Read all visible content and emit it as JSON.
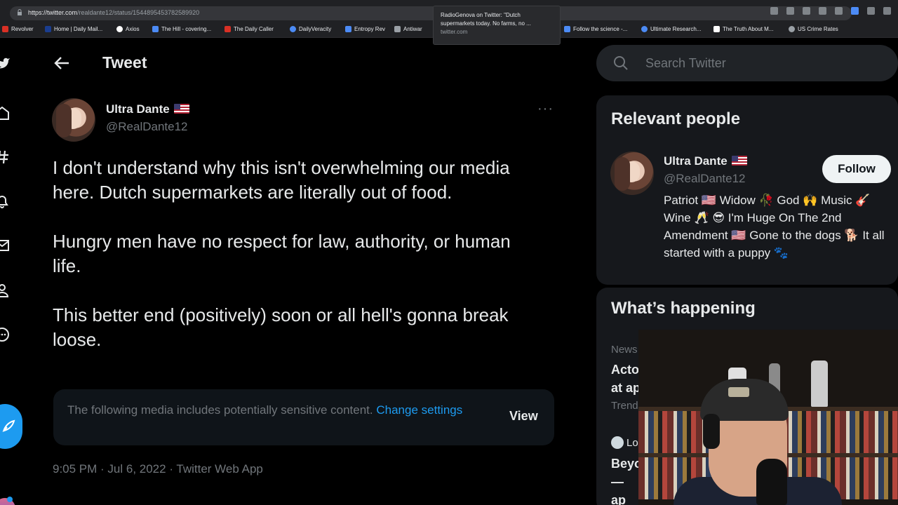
{
  "browser": {
    "url_host": "https://twitter.com",
    "url_path": "/realdante12/status/1544895453782589920",
    "tooltip_title": "RadioGenova on Twitter: \"Dutch supermarkets today. No farms, no ...",
    "tooltip_url": "twitter.com",
    "bookmarks": [
      {
        "label": "Revolver",
        "color": "#d93025"
      },
      {
        "label": "Home | Daily Mail...",
        "color": "#1a3d8f"
      },
      {
        "label": "Axios",
        "color": "#ffffff"
      },
      {
        "label": "The Hill - covering...",
        "color": "#4c8bf5"
      },
      {
        "label": "The Daily Caller",
        "color": "#d93025"
      },
      {
        "label": "DailyVeracity",
        "color": "#4c8bf5"
      },
      {
        "label": "Entropy Rev",
        "color": "#4c8bf5"
      },
      {
        "label": "Antiwar",
        "color": "#9aa0a6"
      },
      {
        "label": "Follow the science -...",
        "color": "#4c8bf5"
      },
      {
        "label": "Ultimate Research...",
        "color": "#4c8bf5"
      },
      {
        "label": "The Truth About M...",
        "color": "#ffffff"
      },
      {
        "label": "US Crime Rates",
        "color": "#9aa0a6"
      }
    ]
  },
  "header": {
    "title": "Tweet"
  },
  "tweet": {
    "display_name": "Ultra Dante",
    "handle": "@RealDante12",
    "more": "···",
    "text": "I don't understand why this isn't overwhelming our media here. Dutch supermarkets are literally out of food.\n\nHungry men have no respect for law, authority, or human life.\n\nThis better end (positively) soon or all hell's gonna break loose.",
    "media_warning": "The following media includes potentially sensitive content.",
    "media_warning_link": "Change settings",
    "view_label": "View",
    "timestamp": "9:05 PM · Jul 6, 2022 · Twitter Web App"
  },
  "search": {
    "placeholder": "Search Twitter"
  },
  "relevant_people": {
    "title": "Relevant people",
    "name": "Ultra Dante",
    "handle": "@RealDante12",
    "follow_label": "Follow",
    "bio": "Patriot 🇺🇸 Widow 🥀 God 🙌 Music 🎸 Wine 🥂 😎 I'm Huge On The 2nd Amendment 🇺🇸 Gone to the dogs 🐕 It all started with a puppy 🐾"
  },
  "whats_happening": {
    "title": "What’s happening",
    "trend1_category": "News",
    "trend1_title": "Acto\nat ap",
    "trend1_sub": "Trend",
    "trend2_source": "Lo",
    "trend2_title": "Beyo\n— ap"
  },
  "colors": {
    "accent": "#1d9bf0",
    "background": "#000000",
    "secondary_text": "#71767b"
  }
}
